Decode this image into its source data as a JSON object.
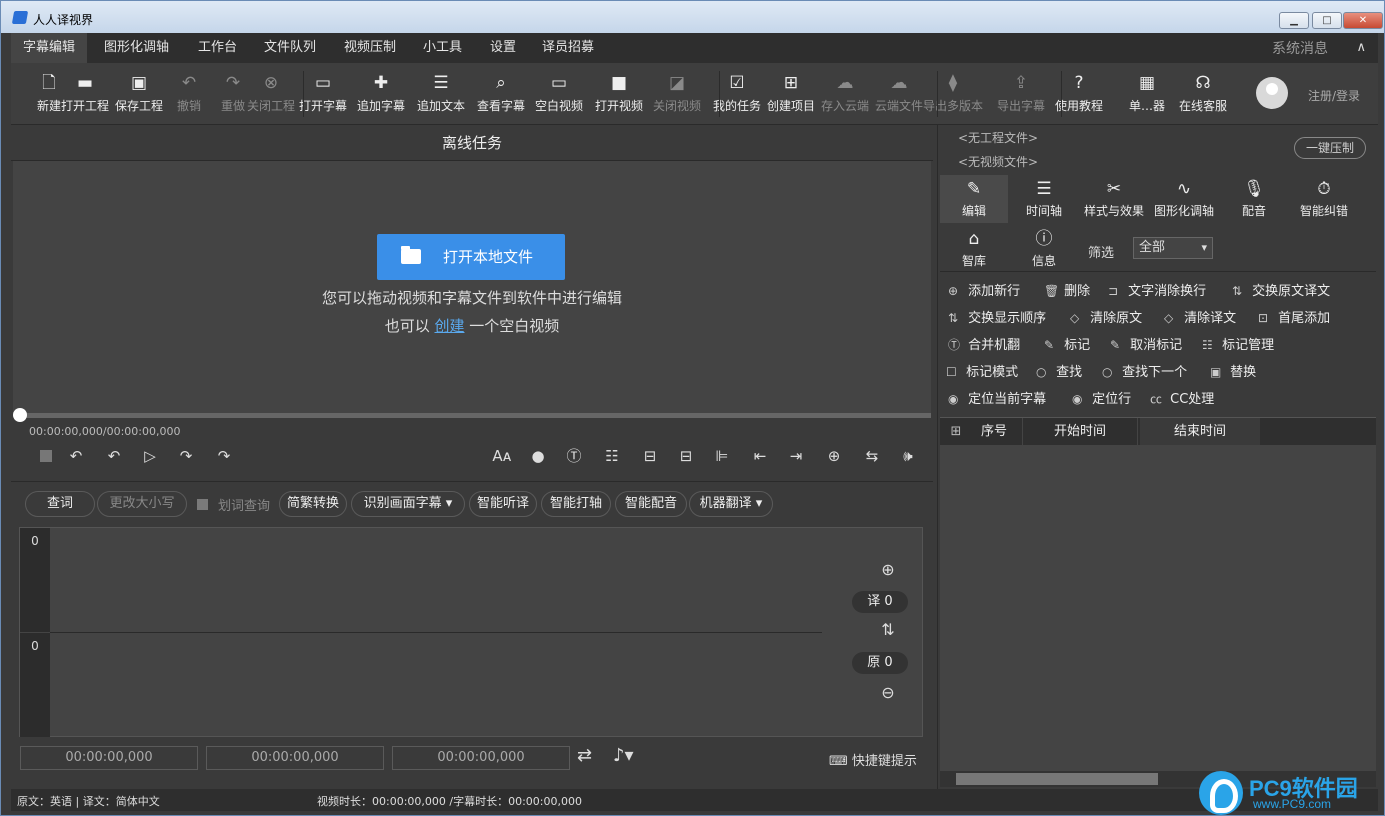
{
  "window": {
    "title": "人人译视界",
    "buttons": {
      "minimize": "▁",
      "maximize": "□",
      "close": "✕"
    }
  },
  "menu": {
    "items": [
      "字幕编辑",
      "图形化调轴",
      "工作台",
      "文件队列",
      "视频压制",
      "小工具",
      "设置",
      "译员招募"
    ],
    "active": "字幕编辑",
    "system_message": "系统消息",
    "collapse": "∧"
  },
  "toolbar": {
    "items": [
      {
        "label": "新建",
        "icon": "new-file-icon",
        "glyph": "🗋",
        "enabled": true
      },
      {
        "label": "打开工程",
        "icon": "folder-icon",
        "glyph": "▬",
        "enabled": true
      },
      {
        "label": "保存工程",
        "icon": "save-icon",
        "glyph": "▣",
        "enabled": true
      },
      {
        "label": "撤销",
        "icon": "undo-icon",
        "glyph": "↶",
        "enabled": false
      },
      {
        "label": "重做",
        "icon": "redo-icon",
        "glyph": "↷",
        "enabled": false
      },
      {
        "label": "关闭工程",
        "icon": "close-circle-icon",
        "glyph": "⊗",
        "enabled": false
      },
      {
        "label": "打开字幕",
        "icon": "open-folder-icon",
        "glyph": "▭",
        "enabled": true
      },
      {
        "label": "追加字幕",
        "icon": "plus-icon",
        "glyph": "✚",
        "enabled": true
      },
      {
        "label": "追加文本",
        "icon": "text-doc-icon",
        "glyph": "☰",
        "enabled": true
      },
      {
        "label": "查看字幕",
        "icon": "view-subtitle-icon",
        "glyph": "⌕",
        "enabled": true
      },
      {
        "label": "空白视频",
        "icon": "blank-video-icon",
        "glyph": "▭",
        "enabled": true
      },
      {
        "label": "打开视频",
        "icon": "video-camera-icon",
        "glyph": "■",
        "enabled": true
      },
      {
        "label": "关闭视频",
        "icon": "video-off-icon",
        "glyph": "◪",
        "enabled": false
      },
      {
        "label": "我的任务",
        "icon": "task-clipboard-icon",
        "glyph": "☑",
        "enabled": true
      },
      {
        "label": "创建项目",
        "icon": "create-project-icon",
        "glyph": "⊞",
        "enabled": true
      },
      {
        "label": "存入云端",
        "icon": "cloud-icon",
        "glyph": "☁",
        "enabled": false
      },
      {
        "label": "云端文件",
        "icon": "cloud-upload-icon",
        "glyph": "☁",
        "enabled": false
      },
      {
        "label": "导出多版本",
        "icon": "export-layers-icon",
        "glyph": "⧫",
        "enabled": false
      },
      {
        "label": "导出字幕",
        "icon": "export-file-icon",
        "glyph": "⇪",
        "enabled": false
      },
      {
        "label": "使用教程",
        "icon": "help-icon",
        "glyph": "?",
        "enabled": true
      },
      {
        "label": "单…器",
        "icon": "calculator-icon",
        "glyph": "▦",
        "enabled": true
      },
      {
        "label": "在线客服",
        "icon": "headset-icon",
        "glyph": "☊",
        "enabled": true
      }
    ],
    "login": "注册/登录"
  },
  "left": {
    "panel_title": "离线任务",
    "open_local": "打开本地文件",
    "hint_line1": "您可以拖动视频和字幕文件到软件中进行编辑",
    "hint_line2_prefix": "也可以 ",
    "hint_line2_link": "创建",
    "hint_line2_suffix": " 一个空白视频",
    "timecode": "00:00:00,000/00:00:00,000",
    "playback": {
      "back3": "↶",
      "back1": "↶",
      "play": "▷",
      "fwd1": "↷",
      "fwd3": "↷"
    },
    "right_tools": [
      "Aᴀ",
      "●",
      "Ⓣ",
      "☷",
      "⊟",
      "⊟",
      "⊫",
      "⇤",
      "⇥",
      "⊕",
      "⇆",
      "🕪"
    ],
    "tools": {
      "lookup": "查词",
      "change_case": "更改大小写",
      "word_lookup": "划词查询",
      "simp_trad": "简繁转换",
      "recognize": "识别画面字幕",
      "smart_listen": "智能听译",
      "smart_axis": "智能打轴",
      "smart_dub": "智能配音",
      "machine_translate": "机器翻译"
    },
    "editor": {
      "trans_line": "0",
      "orig_line": "0",
      "trans_count": "译 0",
      "orig_count": "原 0"
    },
    "times": [
      "00:00:00,000",
      "00:00:00,000",
      "00:00:00,000"
    ],
    "shortcut_hint": "快捷键提示"
  },
  "right": {
    "no_project": "<无工程文件>",
    "no_video": "<无视频文件>",
    "one_key": "一键压制",
    "tabs": [
      {
        "label": "编辑",
        "icon": "pencil-icon",
        "glyph": "✎"
      },
      {
        "label": "时间轴",
        "icon": "timeline-icon",
        "glyph": "☰"
      },
      {
        "label": "样式与效果",
        "icon": "tools-icon",
        "glyph": "✂"
      },
      {
        "label": "图形化调轴",
        "icon": "graph-icon",
        "glyph": "∿"
      },
      {
        "label": "配音",
        "icon": "microphone-icon",
        "glyph": "🎙"
      },
      {
        "label": "智能纠错",
        "icon": "smart-check-icon",
        "glyph": "⏱"
      },
      {
        "label": "智库",
        "icon": "brain-icon",
        "glyph": "⌂"
      },
      {
        "label": "信息",
        "icon": "info-icon",
        "glyph": "ⓘ"
      }
    ],
    "filter_label": "筛选",
    "filter_value": "全部",
    "ops": [
      [
        "添加新行",
        "删除",
        "文字消除换行",
        "交换原文译文"
      ],
      [
        "交换显示顺序",
        "清除原文",
        "清除译文",
        "首尾添加"
      ],
      [
        "合并机翻",
        "标记",
        "取消标记",
        "标记管理"
      ],
      [
        "标记模式",
        "查找",
        "查找下一个",
        "替换"
      ],
      [
        "定位当前字幕",
        "定位行",
        "CC处理"
      ]
    ],
    "table_headers": [
      "序号",
      "开始时间",
      "结束时间"
    ]
  },
  "status": {
    "lang": "原文：英语 | 译文：简体中文",
    "duration": "视频时长：00:00:00,000 /字幕时长：00:00:00,000"
  },
  "watermark": {
    "title": "PC9软件园",
    "url": "www.PC9.com"
  }
}
